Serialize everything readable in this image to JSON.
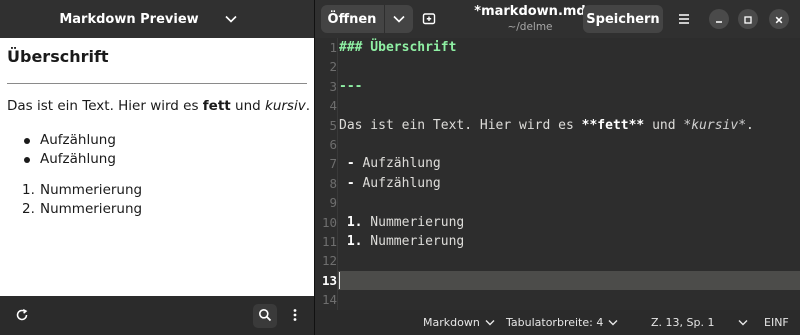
{
  "preview": {
    "title": "Markdown Preview",
    "heading": "Überschrift",
    "para_pre": "Das ist ein Text. Hier wird es ",
    "para_bold": "fett",
    "para_mid": " und ",
    "para_italic": "kursiv",
    "para_end": ".",
    "bullets": [
      "Aufzählung",
      "Aufzählung"
    ],
    "numbered": [
      {
        "num": "1.",
        "text": "Nummerierung"
      },
      {
        "num": "2.",
        "text": "Nummerierung"
      }
    ]
  },
  "header": {
    "open_label": "Öffnen",
    "file_title": "*markdown.md",
    "file_path": "~/delme",
    "save_label": "Speichern"
  },
  "editor": {
    "line_numbers": [
      "1",
      "2",
      "3",
      "4",
      "5",
      "6",
      "7",
      "8",
      "9",
      "10",
      "11",
      "12",
      "13",
      "14"
    ],
    "current_line": "13",
    "lines": {
      "l1": "### Überschrift",
      "l3": "---",
      "l5_pre": "Das ist ein Text. Hier wird es ",
      "l5_bold": "**fett**",
      "l5_mid": " und ",
      "l5_italic": "*kursiv*",
      "l5_end": ".",
      "l7_mark": " - ",
      "l7_text": "Aufzählung",
      "l8_mark": " - ",
      "l8_text": "Aufzählung",
      "l10_num": " 1.",
      "l10_text": " Nummerierung",
      "l11_num": " 1.",
      "l11_text": " Nummerierung"
    }
  },
  "statusbar": {
    "language": "Markdown",
    "tab_width": "Tabulatorbreite: 4",
    "position": "Z. 13, Sp. 1",
    "mode": "EINF"
  },
  "icons": {
    "chevron": "chevron-down-icon",
    "reload": "reload-icon",
    "search": "search-icon",
    "more": "more-vertical-icon",
    "new_tab": "new-tab-icon",
    "menu": "hamburger-menu-icon",
    "minimize": "minimize-icon",
    "maximize": "maximize-icon",
    "close": "close-icon"
  },
  "colors": {
    "heading_syntax": "#8ff0a4",
    "current_line_bg": "#4c4c4a",
    "editor_bg": "#2d2d2d",
    "headerbar_bg": "#303030"
  }
}
